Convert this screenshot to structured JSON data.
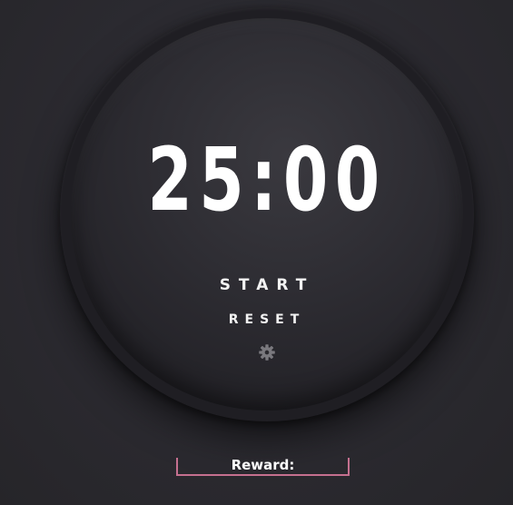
{
  "timer": {
    "display": "25:00"
  },
  "controls": {
    "start_label": "START",
    "reset_label": "RESET",
    "settings_icon": "gear-icon"
  },
  "reward": {
    "label": "Reward:"
  },
  "colors": {
    "background": "#2b2a30",
    "dial": "#1f1e23",
    "text": "#ffffff",
    "accent": "#c5708f",
    "icon": "#7a797e"
  }
}
